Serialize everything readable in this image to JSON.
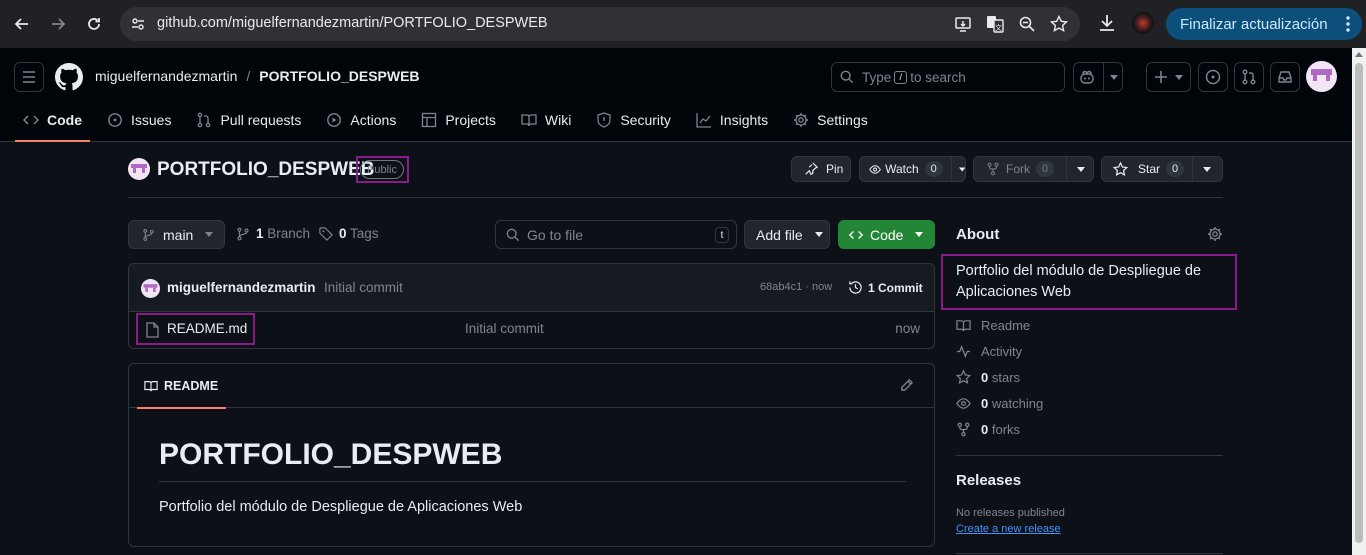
{
  "browser": {
    "url": "github.com/miguelfernandezmartin/PORTFOLIO_DESPWEB",
    "update_button": "Finalizar actualización"
  },
  "header": {
    "owner": "miguelfernandezmartin",
    "separator": "/",
    "repo": "PORTFOLIO_DESPWEB",
    "search_prefix": "Type",
    "search_key": "/",
    "search_suffix": "to search"
  },
  "tabs": [
    {
      "label": "Code",
      "icon": "code-icon"
    },
    {
      "label": "Issues",
      "icon": "issue-icon"
    },
    {
      "label": "Pull requests",
      "icon": "pull-request-icon"
    },
    {
      "label": "Actions",
      "icon": "play-icon"
    },
    {
      "label": "Projects",
      "icon": "table-icon"
    },
    {
      "label": "Wiki",
      "icon": "book-icon"
    },
    {
      "label": "Security",
      "icon": "shield-icon"
    },
    {
      "label": "Insights",
      "icon": "graph-icon"
    },
    {
      "label": "Settings",
      "icon": "gear-icon"
    }
  ],
  "repo": {
    "name": "PORTFOLIO_DESPWEB",
    "visibility": "Public",
    "pin_label": "Pin",
    "watch_label": "Watch",
    "watch_count": "0",
    "fork_label": "Fork",
    "fork_count": "0",
    "star_label": "Star",
    "star_count": "0"
  },
  "toolbar": {
    "branch": "main",
    "branch_count": "1",
    "branch_label": "Branch",
    "tag_count": "0",
    "tag_label": "Tags",
    "goto_placeholder": "Go to file",
    "goto_key": "t",
    "add_file": "Add file",
    "code": "Code"
  },
  "commit": {
    "user": "miguelfernandezmartin",
    "message": "Initial commit",
    "sha_time": "68ab4c1 · now",
    "count_label": "1 Commit"
  },
  "files": [
    {
      "name": "README.md",
      "commit": "Initial commit",
      "age": "now"
    }
  ],
  "readme": {
    "tab_label": "README",
    "heading": "PORTFOLIO_DESPWEB",
    "paragraph": "Portfolio del módulo de Despliegue de Aplicaciones Web"
  },
  "about": {
    "title": "About",
    "description": "Portfolio del módulo de Despliegue de Aplicaciones Web",
    "readme": "Readme",
    "activity": "Activity",
    "stars_count": "0",
    "stars_label": "stars",
    "watching_count": "0",
    "watching_label": "watching",
    "forks_count": "0",
    "forks_label": "forks"
  },
  "releases": {
    "title": "Releases",
    "none": "No releases published",
    "create_link": "Create a new release"
  },
  "colors": {
    "accent_green": "#238636",
    "tab_underline": "#f78166",
    "highlight_box": "#8b1a8b",
    "link_blue": "#4493f8"
  }
}
